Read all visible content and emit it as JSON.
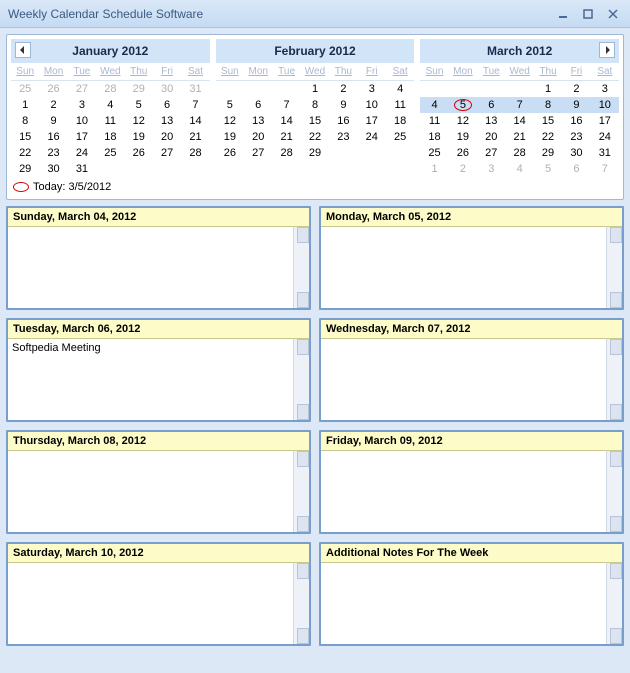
{
  "window": {
    "title": "Weekly Calendar Schedule Software"
  },
  "today": {
    "label": "Today: 3/5/2012"
  },
  "months": [
    {
      "title": "January 2012",
      "dow": [
        "Sun",
        "Mon",
        "Tue",
        "Wed",
        "Thu",
        "Fri",
        "Sat"
      ],
      "weeks": [
        [
          "25",
          "26",
          "27",
          "28",
          "29",
          "30",
          "31"
        ],
        [
          "1",
          "2",
          "3",
          "4",
          "5",
          "6",
          "7"
        ],
        [
          "8",
          "9",
          "10",
          "11",
          "12",
          "13",
          "14"
        ],
        [
          "15",
          "16",
          "17",
          "18",
          "19",
          "20",
          "21"
        ],
        [
          "22",
          "23",
          "24",
          "25",
          "26",
          "27",
          "28"
        ],
        [
          "29",
          "30",
          "31",
          "",
          "",
          "",
          ""
        ]
      ],
      "otherRows": [
        0
      ],
      "nav": "prev"
    },
    {
      "title": "February 2012",
      "dow": [
        "Sun",
        "Mon",
        "Tue",
        "Wed",
        "Thu",
        "Fri",
        "Sat"
      ],
      "weeks": [
        [
          "",
          "",
          "",
          "1",
          "2",
          "3",
          "4"
        ],
        [
          "5",
          "6",
          "7",
          "8",
          "9",
          "10",
          "11"
        ],
        [
          "12",
          "13",
          "14",
          "15",
          "16",
          "17",
          "18"
        ],
        [
          "19",
          "20",
          "21",
          "22",
          "23",
          "24",
          "25"
        ],
        [
          "26",
          "27",
          "28",
          "29",
          "",
          "",
          ""
        ]
      ],
      "otherRows": [],
      "nav": ""
    },
    {
      "title": "March 2012",
      "dow": [
        "Sun",
        "Mon",
        "Tue",
        "Wed",
        "Thu",
        "Fri",
        "Sat"
      ],
      "weeks": [
        [
          "",
          "",
          "",
          "",
          "1",
          "2",
          "3"
        ],
        [
          "4",
          "5",
          "6",
          "7",
          "8",
          "9",
          "10"
        ],
        [
          "11",
          "12",
          "13",
          "14",
          "15",
          "16",
          "17"
        ],
        [
          "18",
          "19",
          "20",
          "21",
          "22",
          "23",
          "24"
        ],
        [
          "25",
          "26",
          "27",
          "28",
          "29",
          "30",
          "31"
        ],
        [
          "1",
          "2",
          "3",
          "4",
          "5",
          "6",
          "7"
        ]
      ],
      "otherRows": [
        5
      ],
      "highlightRow": 1,
      "todayCell": [
        1,
        1
      ],
      "nav": "next"
    }
  ],
  "dayPanels": [
    {
      "title": "Sunday, March 04, 2012",
      "content": ""
    },
    {
      "title": "Monday, March 05, 2012",
      "content": ""
    },
    {
      "title": "Tuesday, March 06, 2012",
      "content": "Softpedia Meeting"
    },
    {
      "title": "Wednesday, March 07, 2012",
      "content": ""
    },
    {
      "title": "Thursday, March 08, 2012",
      "content": ""
    },
    {
      "title": "Friday, March 09, 2012",
      "content": ""
    },
    {
      "title": "Saturday, March 10, 2012",
      "content": ""
    },
    {
      "title": "Additional Notes For The Week",
      "content": ""
    }
  ]
}
